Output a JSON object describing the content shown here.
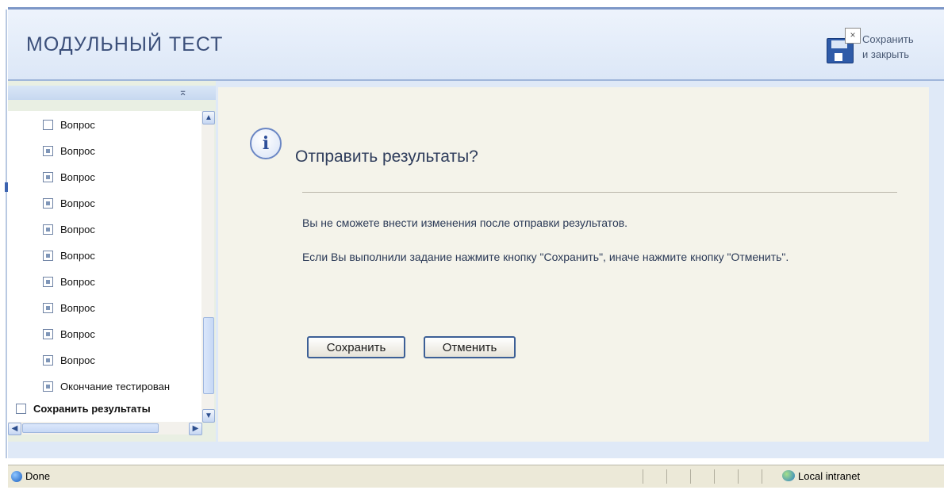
{
  "header": {
    "title": "МОДУЛЬНЫЙ ТЕСТ",
    "save_close_line1": "Сохранить",
    "save_close_line2": "и закрыть"
  },
  "sidebar": {
    "items": [
      {
        "label": "Вопрос",
        "bold": false
      },
      {
        "label": "Вопрос",
        "bold": false
      },
      {
        "label": "Вопрос",
        "bold": false
      },
      {
        "label": "Вопрос",
        "bold": false
      },
      {
        "label": "Вопрос",
        "bold": false
      },
      {
        "label": "Вопрос",
        "bold": false
      },
      {
        "label": "Вопрос",
        "bold": false
      },
      {
        "label": "Вопрос",
        "bold": false
      },
      {
        "label": "Вопрос",
        "bold": false
      },
      {
        "label": "Вопрос",
        "bold": false
      },
      {
        "label": "Окончание тестирован",
        "bold": false
      },
      {
        "label": "Сохранить результаты",
        "bold": true
      }
    ]
  },
  "dialog": {
    "heading": "Отправить результаты?",
    "message1": "Вы не сможете внести изменения после отправки результатов.",
    "message2": "Если Вы выполнили задание нажмите кнопку \"Сохранить\", иначе нажмите кнопку \"Отменить\".",
    "save_label": "Сохранить",
    "cancel_label": "Отменить"
  },
  "statusbar": {
    "status": "Done",
    "zone": "Local intranet"
  },
  "colors": {
    "header_title": "#3b4f7a",
    "button_border": "#3c5f96",
    "content_bg": "#f4f3ea"
  }
}
